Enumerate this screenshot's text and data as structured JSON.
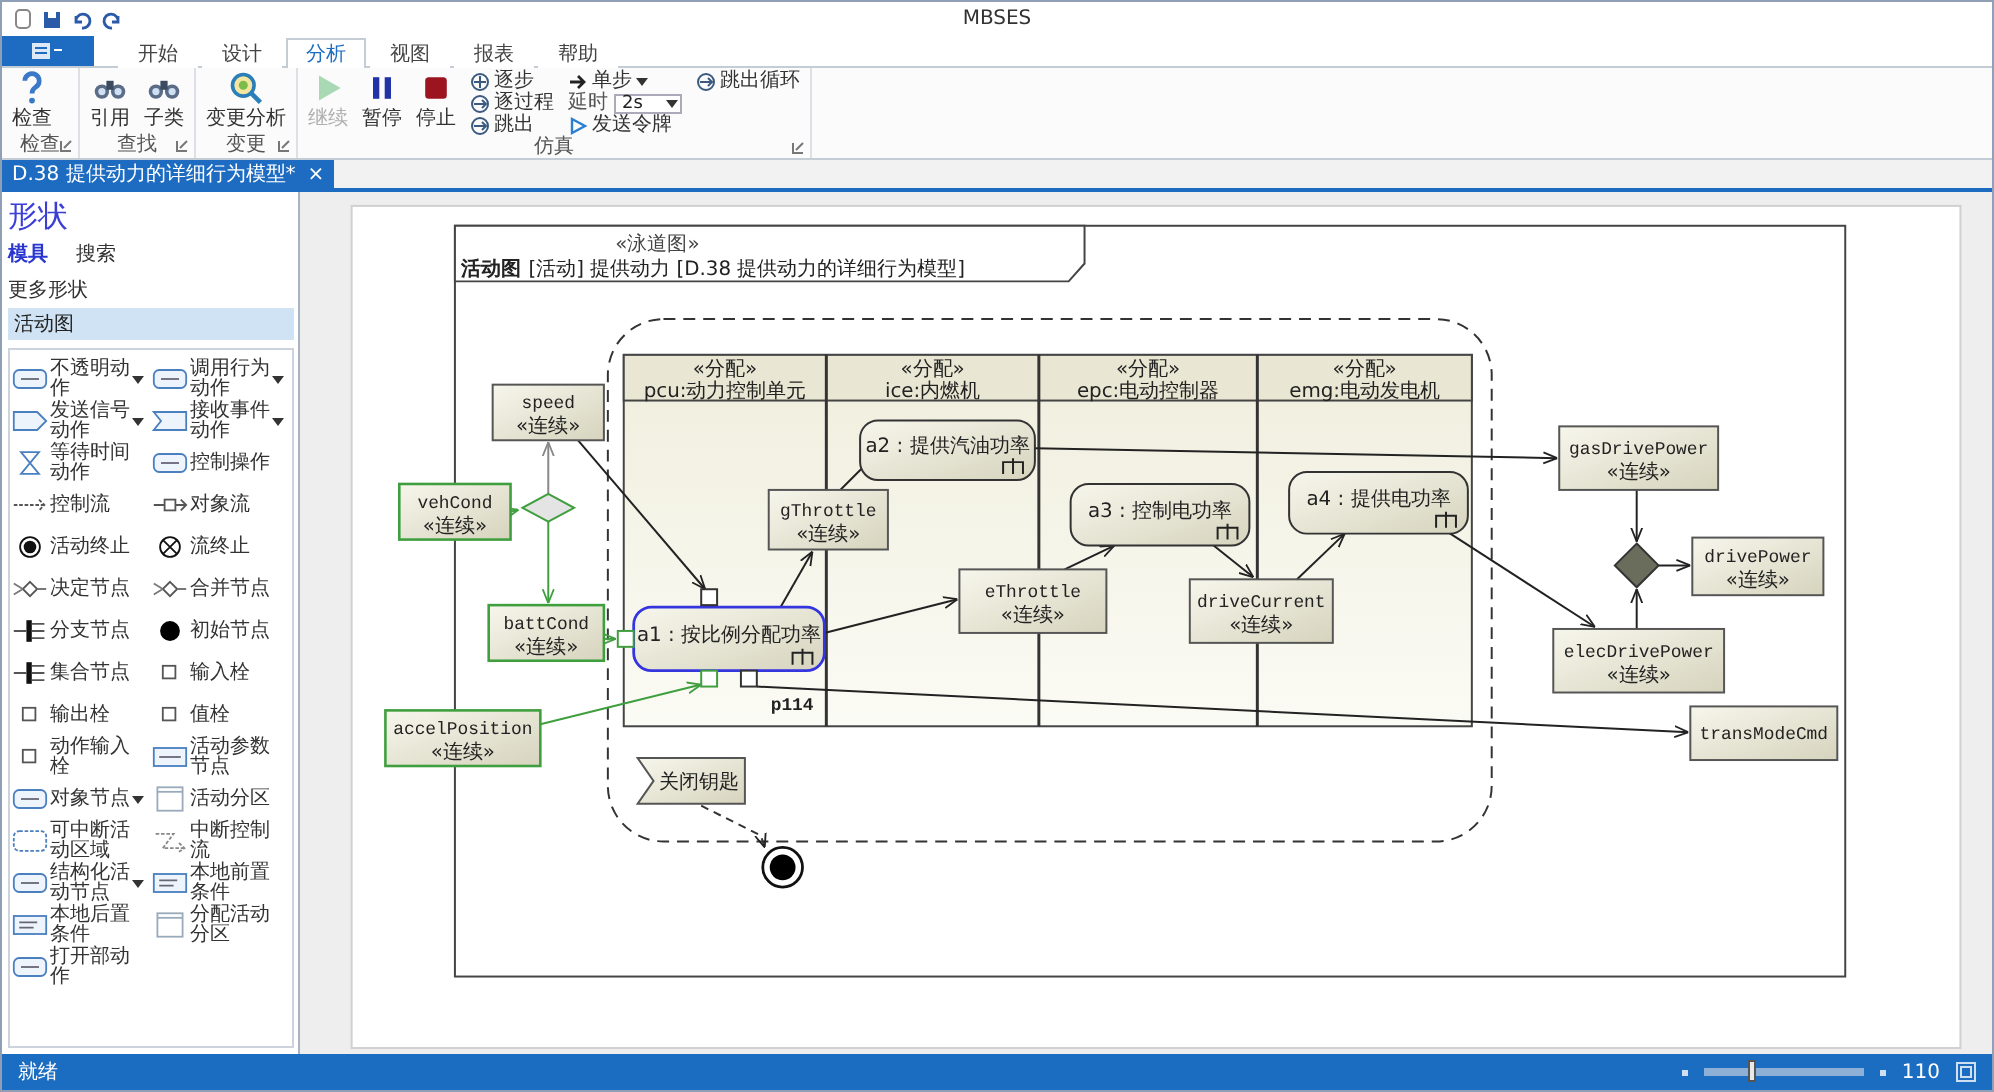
{
  "window": {
    "title": "MBSES"
  },
  "ribbon_tabs": [
    {
      "label": "开始",
      "selected": false
    },
    {
      "label": "设计",
      "selected": false
    },
    {
      "label": "分析",
      "selected": true
    },
    {
      "label": "视图",
      "selected": false
    },
    {
      "label": "报表",
      "selected": false
    },
    {
      "label": "帮助",
      "selected": false
    }
  ],
  "ribbon_groups": [
    {
      "label": "检查",
      "columns": [
        [
          {
            "kind": "large",
            "label": "检查",
            "disabled": false
          }
        ]
      ]
    },
    {
      "label": "查找",
      "columns": [
        [
          {
            "kind": "large",
            "label": "引用",
            "disabled": false
          }
        ],
        [
          {
            "kind": "large",
            "label": "子类",
            "disabled": false
          }
        ]
      ]
    },
    {
      "label": "变更",
      "columns": [
        [
          {
            "kind": "large",
            "label": "变更分析",
            "disabled": false
          }
        ]
      ]
    },
    {
      "label": "仿真",
      "columns": [
        [
          {
            "kind": "large",
            "label": "继续",
            "disabled": true
          }
        ],
        [
          {
            "kind": "large",
            "label": "暂停",
            "disabled": false
          }
        ],
        [
          {
            "kind": "large",
            "label": "停止",
            "disabled": false
          }
        ],
        [
          {
            "kind": "small",
            "label": "逐步",
            "disabled": false
          },
          {
            "kind": "small",
            "label": "逐过程",
            "disabled": false
          },
          {
            "kind": "small",
            "label": "跳出",
            "disabled": false
          }
        ],
        [
          {
            "kind": "dropdown",
            "label": "单步",
            "disabled": false
          },
          {
            "kind": "select",
            "label": "延时",
            "value": "2s"
          },
          {
            "kind": "small",
            "label": "发送令牌",
            "disabled": false
          }
        ],
        [
          {
            "kind": "small",
            "label": "跳出循环",
            "disabled": false
          }
        ]
      ]
    }
  ],
  "document_tab": {
    "label": "D.38 提供动力的详细行为模型*",
    "close": "×"
  },
  "shapes_panel": {
    "title": "形状",
    "tabs": [
      {
        "label": "模具",
        "selected": true
      },
      {
        "label": "搜索",
        "selected": false
      }
    ],
    "more": "更多形状",
    "stencils": [
      {
        "label": "活动图",
        "selected": true
      }
    ],
    "shapes": [
      {
        "label": "不透明动作",
        "has_menu": true
      },
      {
        "label": "调用行为动作",
        "has_menu": true
      },
      {
        "label": "发送信号动作",
        "has_menu": true
      },
      {
        "label": "接收事件动作",
        "has_menu": true
      },
      {
        "label": "等待时间动作",
        "has_menu": false
      },
      {
        "label": "控制操作",
        "has_menu": false
      },
      {
        "label": "控制流",
        "has_menu": false
      },
      {
        "label": "对象流",
        "has_menu": false
      },
      {
        "label": "活动终止",
        "has_menu": false
      },
      {
        "label": "流终止",
        "has_menu": false
      },
      {
        "label": "决定节点",
        "has_menu": false
      },
      {
        "label": "合并节点",
        "has_menu": false
      },
      {
        "label": "分支节点",
        "has_menu": false
      },
      {
        "label": "初始节点",
        "has_menu": false
      },
      {
        "label": "集合节点",
        "has_menu": false
      },
      {
        "label": "输入栓",
        "has_menu": false
      },
      {
        "label": "输出栓",
        "has_menu": false
      },
      {
        "label": "值栓",
        "has_menu": false
      },
      {
        "label": "动作输入栓",
        "has_menu": false
      },
      {
        "label": "活动参数节点",
        "has_menu": false
      },
      {
        "label": "对象节点",
        "has_menu": true
      },
      {
        "label": "活动分区",
        "has_menu": false
      },
      {
        "label": "可中断活动区域",
        "has_menu": false
      },
      {
        "label": "中断控制流",
        "has_menu": false
      },
      {
        "label": "结构化活动节点",
        "has_menu": true
      },
      {
        "label": "本地前置条件",
        "has_menu": false
      },
      {
        "label": "本地后置条件",
        "has_menu": false
      },
      {
        "label": "分配活动分区",
        "has_menu": false
      },
      {
        "label": "打开部动作",
        "has_menu": false
      }
    ]
  },
  "diagram": {
    "frame": {
      "stereotype": "«泳道图»",
      "kind_label": "活动图",
      "title": "[活动] 提供动力 [D.38 提供动力的详细行为模型]"
    },
    "partitions": [
      {
        "stereotype": "«分配»",
        "name": "pcu:动力控制单元"
      },
      {
        "stereotype": "«分配»",
        "name": "ice:内燃机"
      },
      {
        "stereotype": "«分配»",
        "name": "epc:电动控制器"
      },
      {
        "stereotype": "«分配»",
        "name": "emg:电动发电机"
      }
    ],
    "object_nodes": [
      {
        "kind": "object",
        "name": "speed",
        "stereotype": "«连续»"
      },
      {
        "kind": "input",
        "name": "vehCond",
        "stereotype": "«连续»"
      },
      {
        "kind": "input",
        "name": "battCond",
        "stereotype": "«连续»"
      },
      {
        "kind": "input",
        "name": "accelPosition",
        "stereotype": "«连续»"
      },
      {
        "kind": "object",
        "name": "gThrottle",
        "stereotype": "«连续»"
      },
      {
        "kind": "object",
        "name": "eThrottle",
        "stereotype": "«连续»"
      },
      {
        "kind": "object",
        "name": "driveCurrent",
        "stereotype": "«连续»"
      },
      {
        "kind": "object",
        "name": "gasDrivePower",
        "stereotype": "«连续»"
      },
      {
        "kind": "object",
        "name": "drivePower",
        "stereotype": "«连续»"
      },
      {
        "kind": "object",
        "name": "elecDrivePower",
        "stereotype": "«连续»"
      },
      {
        "kind": "object",
        "name": "transModeCmd"
      }
    ],
    "actions": [
      {
        "name": "a1 : 按比例分配功率",
        "selected": true
      },
      {
        "name": "a2 : 提供汽油功率",
        "selected": false
      },
      {
        "name": "a3 : 控制电功率",
        "selected": false
      },
      {
        "name": "a4 : 提供电功率",
        "selected": false
      }
    ],
    "pin_label": "p114",
    "accept_event": "关闭钥匙"
  },
  "status_bar": {
    "text": "就绪",
    "zoom": {
      "level": 0.3,
      "value": "110"
    }
  }
}
